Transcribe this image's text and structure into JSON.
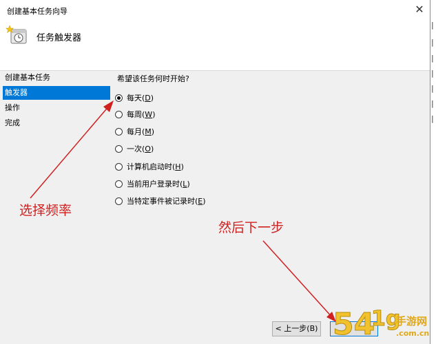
{
  "window": {
    "title": "创建基本任务向导",
    "close_glyph": "✕",
    "header_title": "任务触发器"
  },
  "steps": [
    {
      "label": "创建基本任务",
      "active": false
    },
    {
      "label": "触发器",
      "active": true
    },
    {
      "label": "操作",
      "active": false
    },
    {
      "label": "完成",
      "active": false
    }
  ],
  "trigger": {
    "question": "希望该任务何时开始?",
    "options": [
      {
        "label": "每天",
        "key": "D",
        "checked": true
      },
      {
        "label": "每周",
        "key": "W",
        "checked": false
      },
      {
        "label": "每月",
        "key": "M",
        "checked": false
      },
      {
        "label": "一次",
        "key": "O",
        "checked": false
      },
      {
        "label": "计算机启动时",
        "key": "H",
        "checked": false
      },
      {
        "label": "当前用户登录时",
        "key": "L",
        "checked": false
      },
      {
        "label": "当特定事件被记录时",
        "key": "E",
        "checked": false
      }
    ]
  },
  "buttons": {
    "back": "< 上一步(B)"
  },
  "annotations": {
    "choose_frequency": "选择频率",
    "then_next": "然后下一步",
    "color": "#d02020"
  },
  "background_strip": {
    "glyphs": [
      "|",
      "|",
      "|",
      "|",
      "|",
      "|",
      "|"
    ]
  },
  "watermark": {
    "digits": "54",
    "rest": "1g",
    "cn": "手游网",
    "domain": ".com.cn"
  },
  "icons": {
    "header": "task-scheduler-clock-icon",
    "close": "close-icon"
  }
}
